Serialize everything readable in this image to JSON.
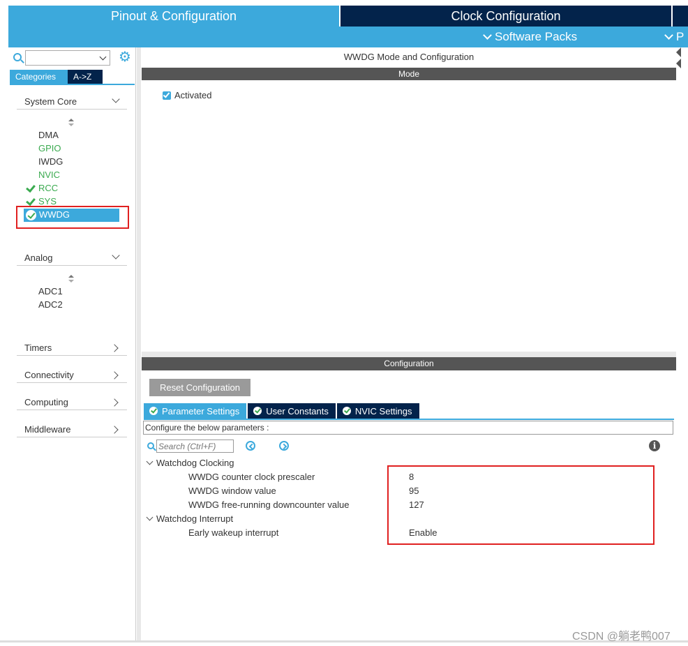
{
  "tabs": {
    "pinout": "Pinout & Configuration",
    "clock": "Clock Configuration",
    "software_packs": "Software Packs",
    "more": "P"
  },
  "sidebar": {
    "category_tab": "Categories",
    "az_tab": "A->Z",
    "system_core": {
      "label": "System Core",
      "items": [
        "DMA",
        "GPIO",
        "IWDG",
        "NVIC",
        "RCC",
        "SYS",
        "WWDG"
      ]
    },
    "analog": {
      "label": "Analog",
      "items": [
        "ADC1",
        "ADC2"
      ]
    },
    "timers": "Timers",
    "connectivity": "Connectivity",
    "computing": "Computing",
    "middleware": "Middleware"
  },
  "mode": {
    "title": "WWDG Mode and Configuration",
    "bar": "Mode",
    "activated_label": "Activated"
  },
  "config": {
    "bar": "Configuration",
    "reset_button": "Reset Configuration",
    "tabs": [
      "Parameter Settings",
      "User Constants",
      "NVIC Settings"
    ],
    "configure_text": "Configure the below parameters :",
    "search_placeholder": "Search (Ctrl+F)",
    "groups": [
      {
        "name": "Watchdog Clocking",
        "params": [
          {
            "name": "WWDG counter clock prescaler",
            "value": "8"
          },
          {
            "name": "WWDG window value",
            "value": "95"
          },
          {
            "name": "WWDG free-running downcounter value",
            "value": "127"
          }
        ]
      },
      {
        "name": "Watchdog Interrupt",
        "params": [
          {
            "name": "Early wakeup interrupt",
            "value": "Enable"
          }
        ]
      }
    ]
  },
  "watermark": "CSDN @躺老鸭007",
  "colors": {
    "accent_blue": "#3ca9dc",
    "navy": "#03234b",
    "green": "#3aaa4f",
    "highlight_red": "#e02020"
  }
}
